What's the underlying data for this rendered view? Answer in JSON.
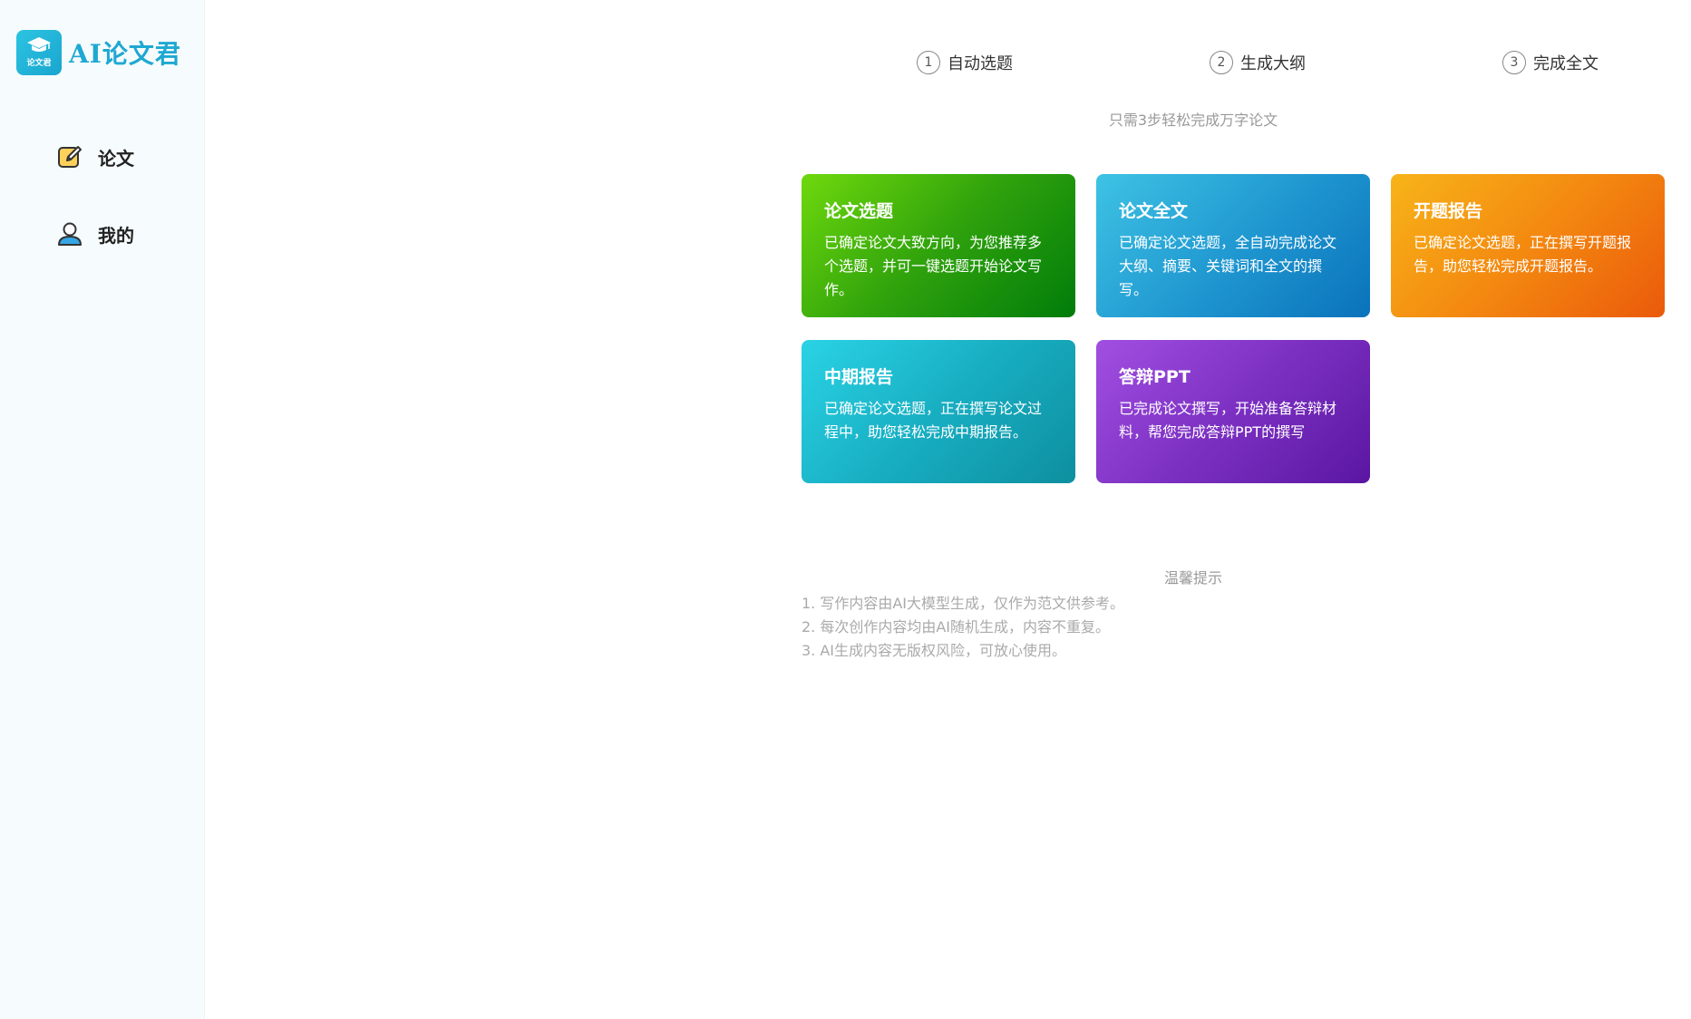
{
  "brand": {
    "logo_text": "论文君",
    "name": "AI论文君"
  },
  "sidebar": {
    "items": [
      {
        "label": "论文",
        "icon": "edit-icon"
      },
      {
        "label": "我的",
        "icon": "user-icon"
      }
    ]
  },
  "steps": [
    {
      "num": "1",
      "label": "自动选题"
    },
    {
      "num": "2",
      "label": "生成大纲"
    },
    {
      "num": "3",
      "label": "完成全文"
    }
  ],
  "subtitle": "只需3步轻松完成万字论文",
  "cards": [
    {
      "title": "论文选题",
      "desc": "已确定论文大致方向，为您推荐多个选题，并可一键选题开始论文写作。"
    },
    {
      "title": "论文全文",
      "desc": "已确定论文选题，全自动完成论文大纲、摘要、关键词和全文的撰写。"
    },
    {
      "title": "开题报告",
      "desc": "已确定论文选题，正在撰写开题报告，助您轻松完成开题报告。"
    },
    {
      "title": "中期报告",
      "desc": "已确定论文选题，正在撰写论文过程中，助您轻松完成中期报告。"
    },
    {
      "title": "答辩PPT",
      "desc": "已完成论文撰写，开始准备答辩材料，帮您完成答辩PPT的撰写"
    }
  ],
  "tips": {
    "title": "温馨提示",
    "items": [
      "1. 写作内容由AI大模型生成，仅作为范文供参考。",
      "2. 每次创作内容均由AI随机生成，内容不重复。",
      "3. AI生成内容无版权风险，可放心使用。"
    ]
  },
  "colors": {
    "brand": "#1fa8d2",
    "sidebar_bg": "#f6fcfd",
    "card_green": "#2fa20c",
    "card_blue": "#1e95cf",
    "card_orange": "#f48910",
    "card_teal": "#18aec2",
    "card_purple": "#7c30c2"
  }
}
